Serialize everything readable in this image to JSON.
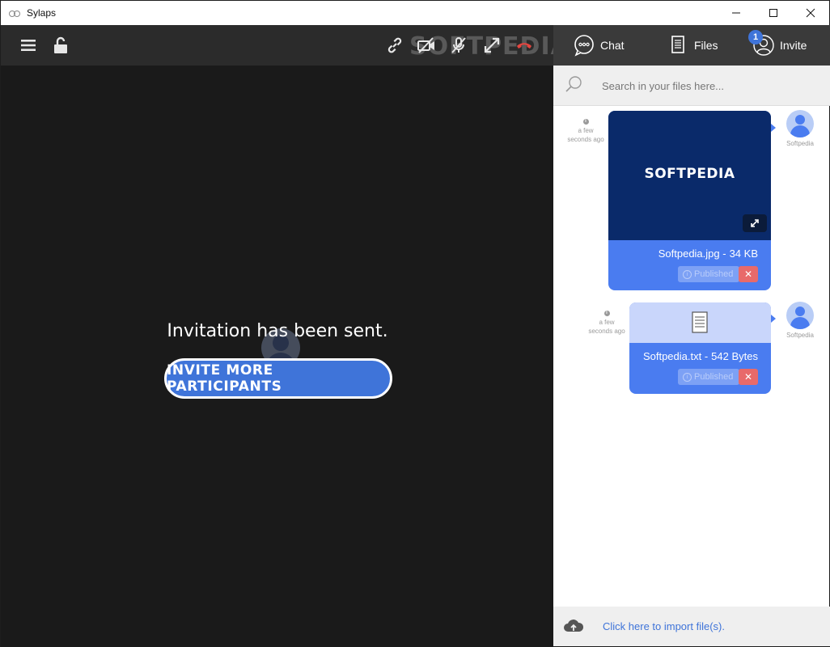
{
  "window": {
    "title": "Sylaps"
  },
  "toolbar": {
    "icons": [
      "menu-icon",
      "unlock-icon",
      "link-icon",
      "video-off-icon",
      "mic-off-icon",
      "fullscreen-icon",
      "hangup-icon"
    ],
    "watermark": "SOFTPEDIA"
  },
  "main": {
    "message": "Invitation has been sent.",
    "invite_button": "INVITE MORE PARTICIPANTS"
  },
  "panel": {
    "tabs": [
      {
        "label": "Chat",
        "icon": "chat-bubble-icon"
      },
      {
        "label": "Files",
        "icon": "document-icon"
      },
      {
        "label": "Invite",
        "icon": "user-add-icon",
        "badge": "1"
      }
    ],
    "search": {
      "placeholder": "Search in your files here..."
    },
    "files": [
      {
        "time": "a few seconds ago",
        "info_icon": "i",
        "name": "Softpedia.jpg -",
        "size": "34 KB",
        "status": "Published",
        "thumbnail_text": "SOFTPEDIA",
        "type": "image",
        "user": "Softpedia"
      },
      {
        "time": "a few seconds ago",
        "info_icon": "i",
        "name": "Softpedia.txt -",
        "size": "542 Bytes",
        "status": "Published",
        "type": "text",
        "user": "Softpedia"
      }
    ],
    "import_label": "Click here to import file(s)."
  },
  "colors": {
    "accent": "#3f74d9",
    "card": "#4a7cf0",
    "video_bg": "#1a1a1a",
    "delete": "#e86a6a"
  }
}
